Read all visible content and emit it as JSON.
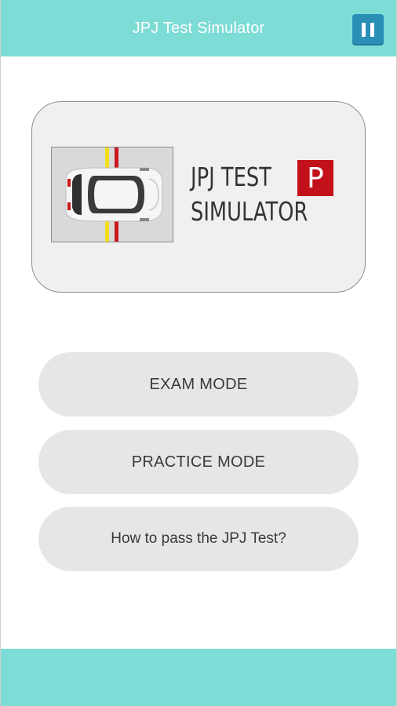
{
  "header": {
    "title": "JPJ Test Simulator",
    "pause_icon": "pause-icon"
  },
  "logo": {
    "line1": "JPJ TEST",
    "line2": "SIMULATOR",
    "badge": "P",
    "car_icon": "car-top-view-icon"
  },
  "menu": {
    "exam_label": "EXAM MODE",
    "practice_label": "PRACTICE MODE",
    "howto_label": "How to pass the JPJ Test?"
  },
  "colors": {
    "accent": "#7ddcd6",
    "pause_button": "#2a8fb6",
    "badge_red": "#c2111a",
    "button_bg": "#e6e6e6"
  }
}
